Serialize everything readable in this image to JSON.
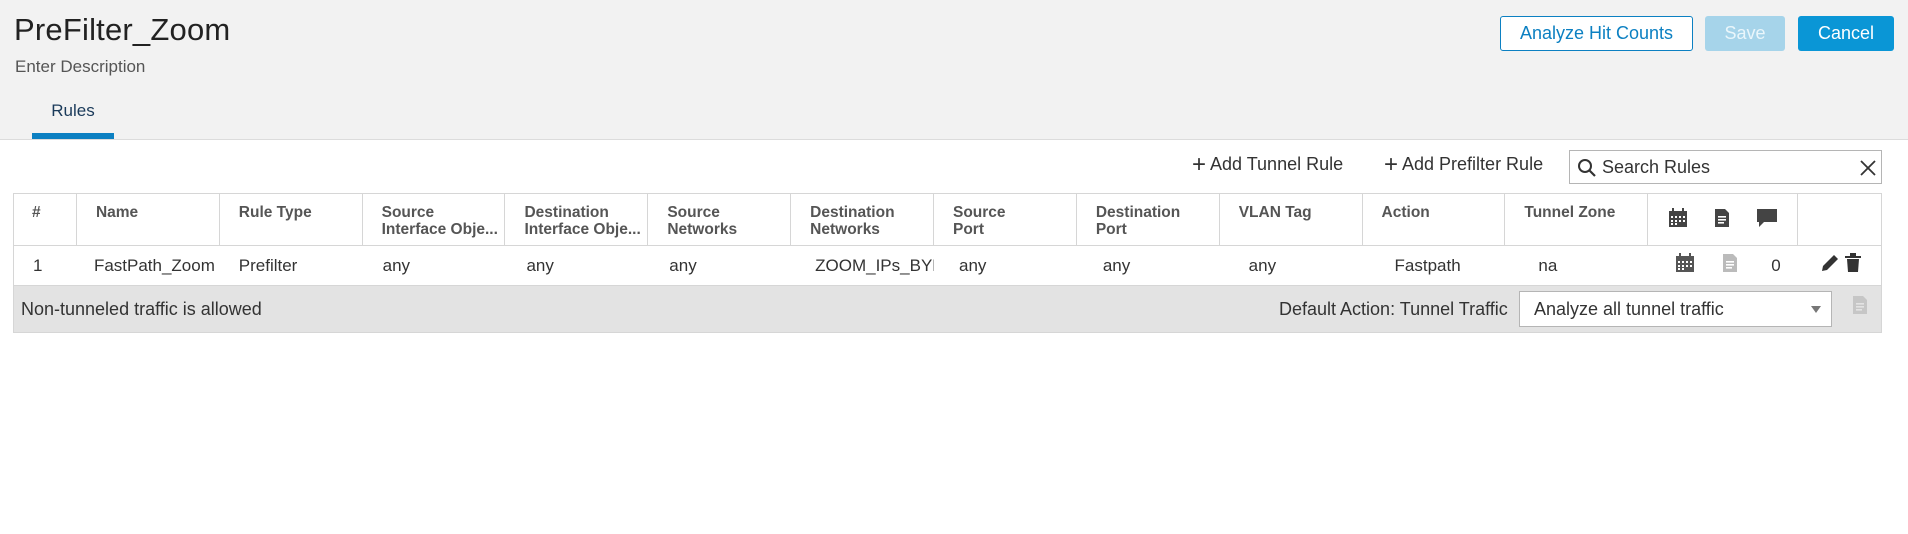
{
  "page": {
    "title": "PreFilter_Zoom",
    "description": "Enter Description"
  },
  "header_buttons": {
    "analyze": "Analyze Hit Counts",
    "save": "Save",
    "cancel": "Cancel"
  },
  "tabs": [
    {
      "label": "Rules",
      "active": true
    }
  ],
  "toolbar": {
    "add_tunnel_rule": "Add Tunnel Rule",
    "add_prefilter_rule": "Add Prefilter Rule",
    "search_placeholder": "Search Rules"
  },
  "table": {
    "headers": [
      {
        "line1": "#",
        "line2": ""
      },
      {
        "line1": "Name",
        "line2": ""
      },
      {
        "line1": "Rule Type",
        "line2": ""
      },
      {
        "line1": "Source",
        "line2": "Interface Obje..."
      },
      {
        "line1": "Destination",
        "line2": "Interface Obje..."
      },
      {
        "line1": "Source",
        "line2": "Networks"
      },
      {
        "line1": "Destination",
        "line2": "Networks"
      },
      {
        "line1": "Source",
        "line2": "Port"
      },
      {
        "line1": "Destination",
        "line2": "Port"
      },
      {
        "line1": "VLAN Tag",
        "line2": ""
      },
      {
        "line1": "Action",
        "line2": ""
      },
      {
        "line1": "Tunnel Zone",
        "line2": ""
      }
    ],
    "header_icons": [
      "calendar-icon",
      "document-icon",
      "comment-icon"
    ],
    "rows": [
      {
        "num": "1",
        "name": "FastPath_Zoom",
        "rule_type": "Prefilter",
        "src_intf": "any",
        "dst_intf": "any",
        "src_networks": "any",
        "dst_networks": "ZOOM_IPs_BYPASS",
        "src_port": "any",
        "dst_port": "any",
        "vlan": "any",
        "action": "Fastpath",
        "tunnel_zone": "na",
        "comments": "0"
      }
    ],
    "footer": {
      "text": "Non-tunneled traffic is allowed",
      "default_action_label": "Default Action: Tunnel Traffic",
      "default_action_value": "Analyze all tunnel traffic"
    }
  },
  "colors": {
    "accent": "#0c80c2",
    "cancel_bg": "#0a96d6",
    "save_disabled_bg": "#a6d4ea",
    "header_bg": "#f2f2f2",
    "footer_bg": "#e3e3e3"
  }
}
